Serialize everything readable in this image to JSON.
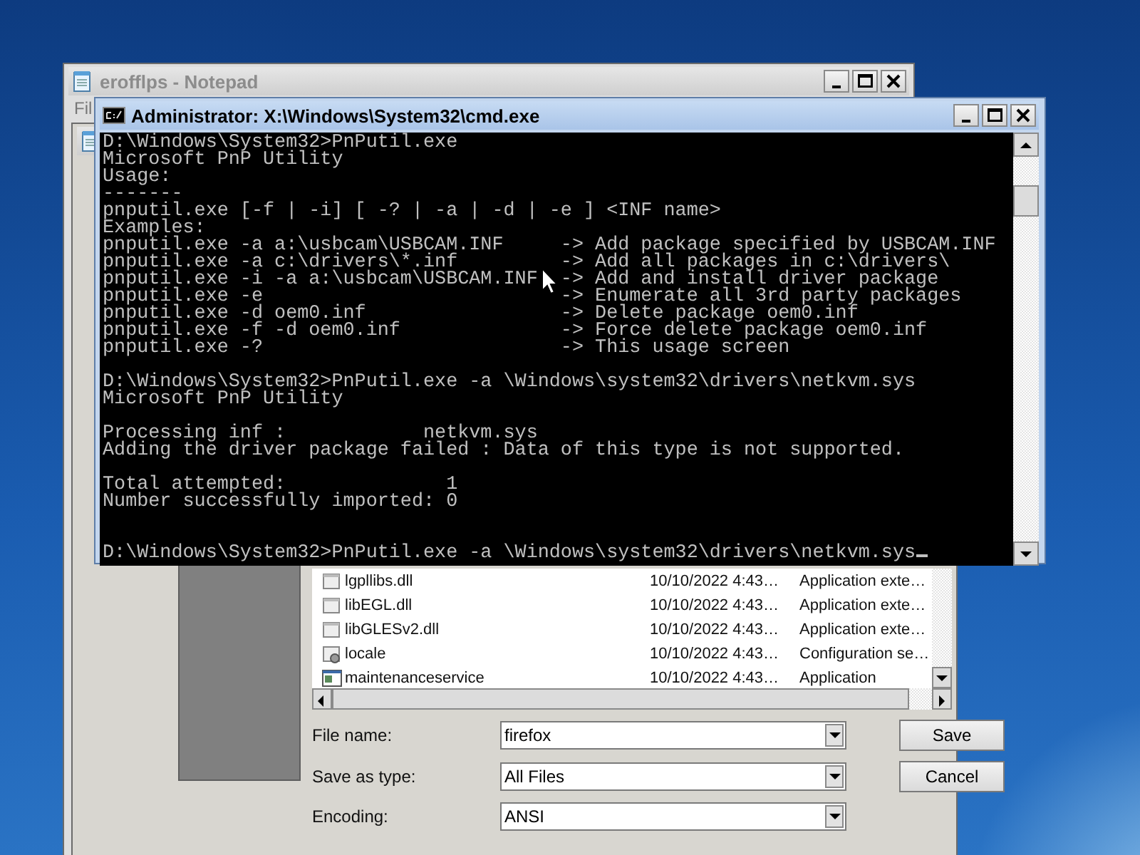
{
  "desktop": {
    "notepad": {
      "title": "erofflps - Notepad",
      "menu": [
        "Fil"
      ]
    },
    "save_dialog": {
      "files": [
        {
          "kind": "dll",
          "name": "lgpllibs.dll",
          "date": "10/10/2022 4:43…",
          "type": "Application exte…"
        },
        {
          "kind": "dll",
          "name": "libEGL.dll",
          "date": "10/10/2022 4:43…",
          "type": "Application exte…"
        },
        {
          "kind": "dll",
          "name": "libGLESv2.dll",
          "date": "10/10/2022 4:43…",
          "type": "Application exte…"
        },
        {
          "kind": "config",
          "name": "locale",
          "date": "10/10/2022 4:43…",
          "type": "Configuration se…"
        },
        {
          "kind": "app",
          "name": "maintenanceservice",
          "date": "10/10/2022 4:43…",
          "type": "Application"
        }
      ],
      "fields": [
        {
          "label": "File name:",
          "value": "firefox"
        },
        {
          "label": "Save as type:",
          "value": "All Files"
        },
        {
          "label": "Encoding:",
          "value": "ANSI"
        }
      ],
      "buttons": [
        "Save",
        "Cancel"
      ]
    },
    "console": {
      "title": "Administrator: X:\\Windows\\System32\\cmd.exe",
      "cursor_visible": true,
      "lines": [
        {
          "kind": "text",
          "text": "D:\\Windows\\System32>PnPutil.exe"
        },
        {
          "kind": "text",
          "text": "Microsoft PnP Utility"
        },
        {
          "kind": "text",
          "text": "Usage:"
        },
        {
          "kind": "text",
          "text": "-------"
        },
        {
          "kind": "text",
          "text": "pnputil.exe [-f | -i] [ -? | -a | -d | -e ] <INF name>"
        },
        {
          "kind": "text",
          "text": "Examples:"
        },
        {
          "kind": "example",
          "command": "pnputil.exe -a a:\\usbcam\\USBCAM.INF",
          "description": "-> Add package specified by USBCAM.INF"
        },
        {
          "kind": "example",
          "command": "pnputil.exe -a c:\\drivers\\*.inf",
          "description": "-> Add all packages in c:\\drivers\\"
        },
        {
          "kind": "example",
          "command": "pnputil.exe -i -a a:\\usbcam\\USBCAM.INF",
          "description": "-> Add and install driver package"
        },
        {
          "kind": "example",
          "command": "pnputil.exe -e",
          "description": "-> Enumerate all 3rd party packages"
        },
        {
          "kind": "example",
          "command": "pnputil.exe -d oem0.inf",
          "description": "-> Delete package oem0.inf"
        },
        {
          "kind": "example",
          "command": "pnputil.exe -f -d oem0.inf",
          "description": "-> Force delete package oem0.inf"
        },
        {
          "kind": "example",
          "command": "pnputil.exe -?",
          "description": "-> This usage screen"
        },
        {
          "kind": "blank"
        },
        {
          "kind": "text",
          "text": "D:\\Windows\\System32>PnPutil.exe -a \\Windows\\system32\\drivers\\netkvm.sys"
        },
        {
          "kind": "text",
          "text": "Microsoft PnP Utility"
        },
        {
          "kind": "blank"
        },
        {
          "kind": "text",
          "text": "Processing inf :            netkvm.sys"
        },
        {
          "kind": "text",
          "text": "Adding the driver package failed : Data of this type is not supported."
        },
        {
          "kind": "blank"
        },
        {
          "kind": "text",
          "text": "Total attempted:              1"
        },
        {
          "kind": "text",
          "text": "Number successfully imported: 0"
        },
        {
          "kind": "blank"
        },
        {
          "kind": "blank"
        },
        {
          "kind": "text",
          "text": "D:\\Windows\\System32>PnPutil.exe -a \\Windows\\system32\\drivers\\netkvm.sys"
        }
      ]
    }
  }
}
